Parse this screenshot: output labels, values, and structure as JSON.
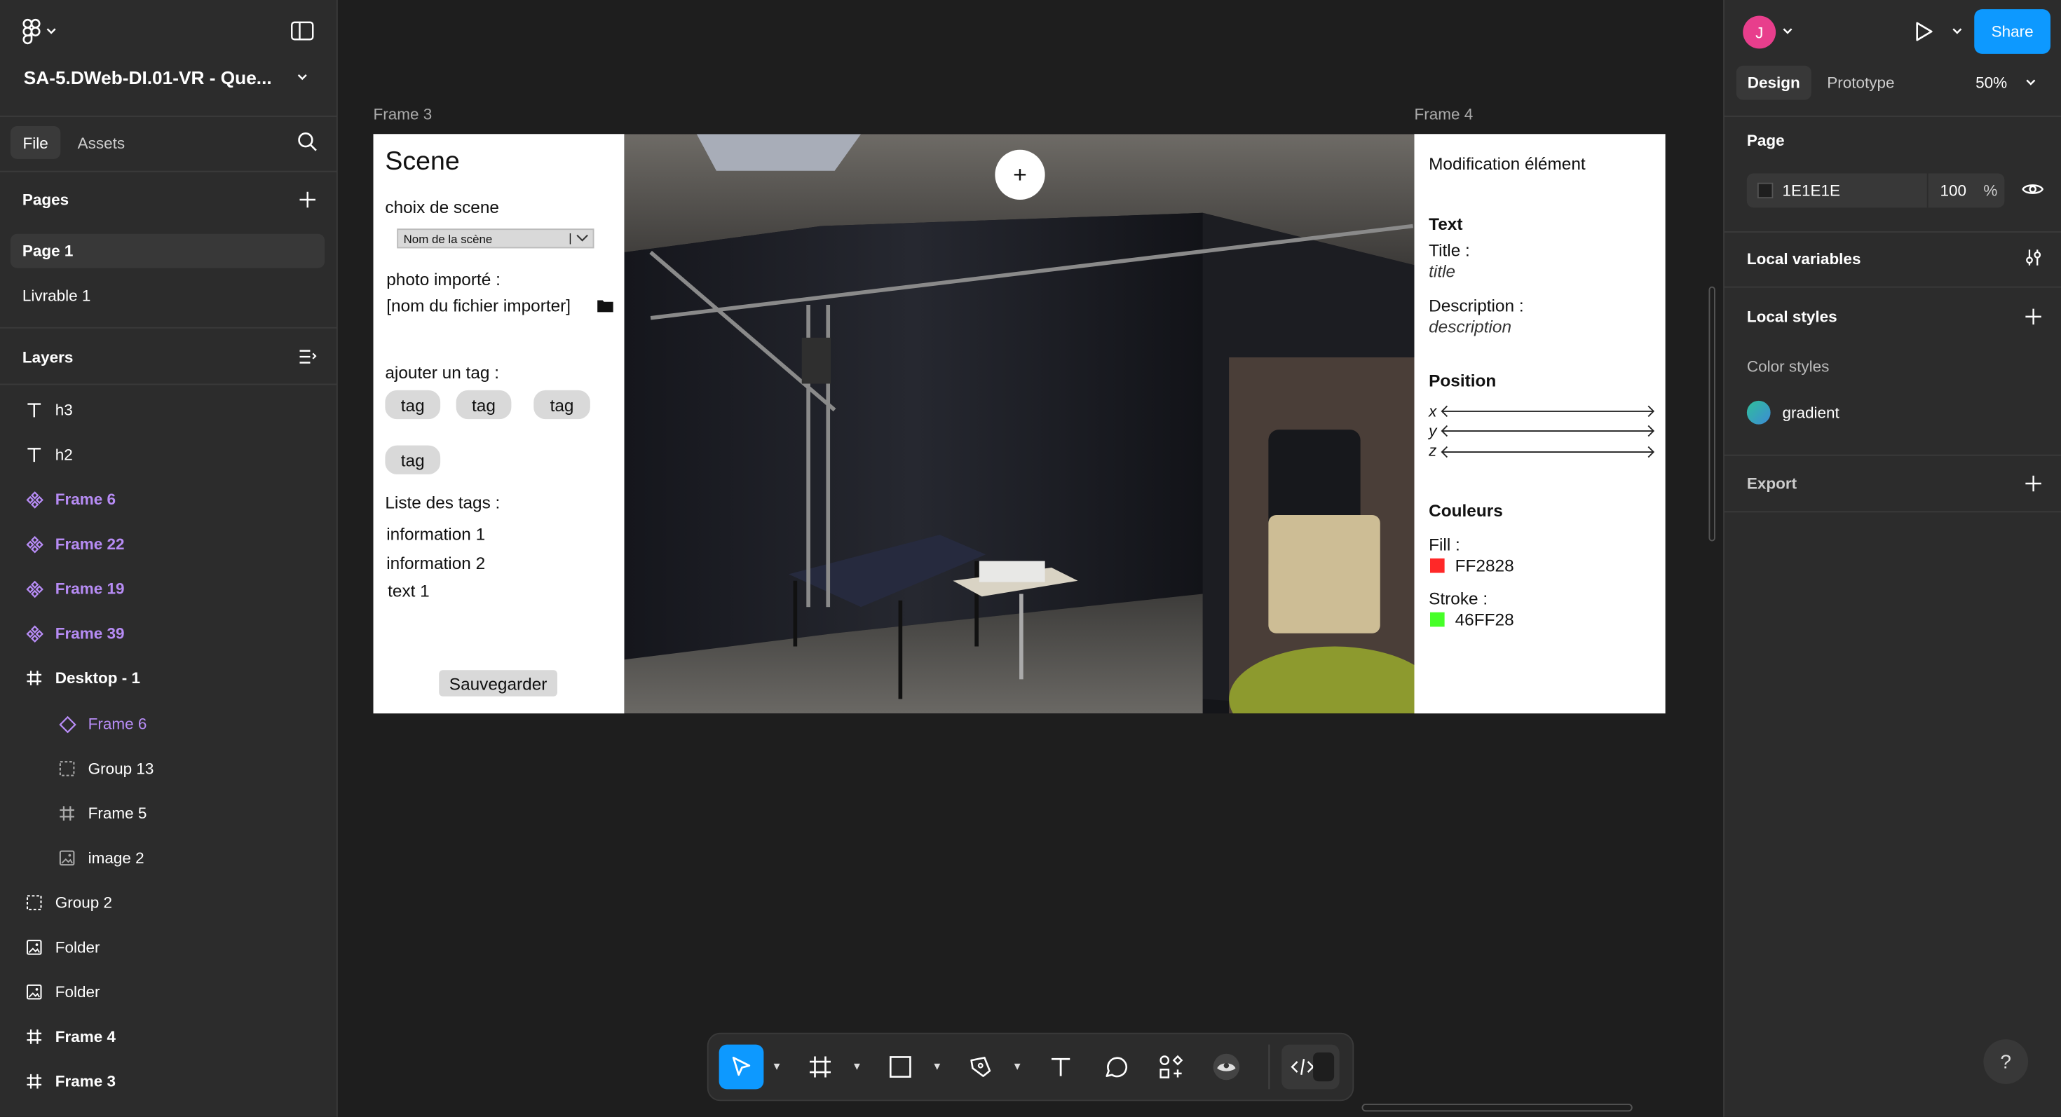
{
  "left_panel": {
    "file_title": "SA-5.DWeb-DI.01-VR - Que...",
    "tabs": [
      "File",
      "Assets"
    ],
    "pages_header": "Pages",
    "pages": [
      "Page 1",
      "Livrable 1"
    ],
    "layers_header": "Layers",
    "layers": [
      {
        "name": "h3",
        "icon": "text-icon"
      },
      {
        "name": "h2",
        "icon": "text-icon"
      },
      {
        "name": "Frame 6",
        "icon": "component-icon"
      },
      {
        "name": "Frame 22",
        "icon": "component-icon"
      },
      {
        "name": "Frame 19",
        "icon": "component-icon"
      },
      {
        "name": "Frame 39",
        "icon": "component-icon"
      },
      {
        "name": "Desktop - 1",
        "icon": "frame-icon"
      },
      {
        "name": "Frame 6",
        "icon": "instance-icon"
      },
      {
        "name": "Group 13",
        "icon": "group-icon"
      },
      {
        "name": "Frame 5",
        "icon": "frame-icon"
      },
      {
        "name": "image 2",
        "icon": "image-icon"
      },
      {
        "name": "Group 2",
        "icon": "group-icon"
      },
      {
        "name": "Folder",
        "icon": "image-icon"
      },
      {
        "name": "Folder",
        "icon": "image-icon"
      },
      {
        "name": "Frame 4",
        "icon": "frame-icon"
      },
      {
        "name": "Frame 3",
        "icon": "frame-icon"
      }
    ]
  },
  "right_panel": {
    "avatar_letter": "J",
    "share_label": "Share",
    "tabs": [
      "Design",
      "Prototype"
    ],
    "zoom": "50%",
    "page_header": "Page",
    "page_color": "1E1E1E",
    "page_opacity": "100",
    "percent": "%",
    "local_variables": "Local variables",
    "local_styles": "Local styles",
    "color_styles": "Color styles",
    "style_name": "gradient",
    "export": "Export"
  },
  "canvas": {
    "frame3_label": "Frame 3",
    "frame4_label": "Frame 4",
    "scene": {
      "title": "Scene",
      "choice_label": "choix de scene",
      "select_value": "Nom de la scène",
      "photo_label": "photo importé :",
      "file_name": "[nom du fichier importer]",
      "add_tag_label": "ajouter un tag :",
      "tags": [
        "tag",
        "tag",
        "tag",
        "tag"
      ],
      "tag_list_label": "Liste des tags :",
      "tag_items": [
        "information 1",
        "information 2",
        "text 1"
      ],
      "save_label": "Sauvegarder"
    },
    "modif": {
      "title": "Modification élément",
      "text_header": "Text",
      "title_label": "Title :",
      "title_value": "title",
      "description_label": "Description :",
      "description_value": "description",
      "position_header": "Position",
      "axes": [
        "x",
        "y",
        "z"
      ],
      "colors_header": "Couleurs",
      "fill_label": "Fill :",
      "fill_value": "FF2828",
      "stroke_label": "Stroke :",
      "stroke_value": "46FF28"
    },
    "plus_symbol": "+"
  },
  "colors": {
    "accent": "#0d99ff",
    "fill": "#FF2828",
    "stroke": "#46FF28",
    "avatar": "#e83e8c",
    "component_purple": "#b78cf5"
  },
  "help_label": "?"
}
